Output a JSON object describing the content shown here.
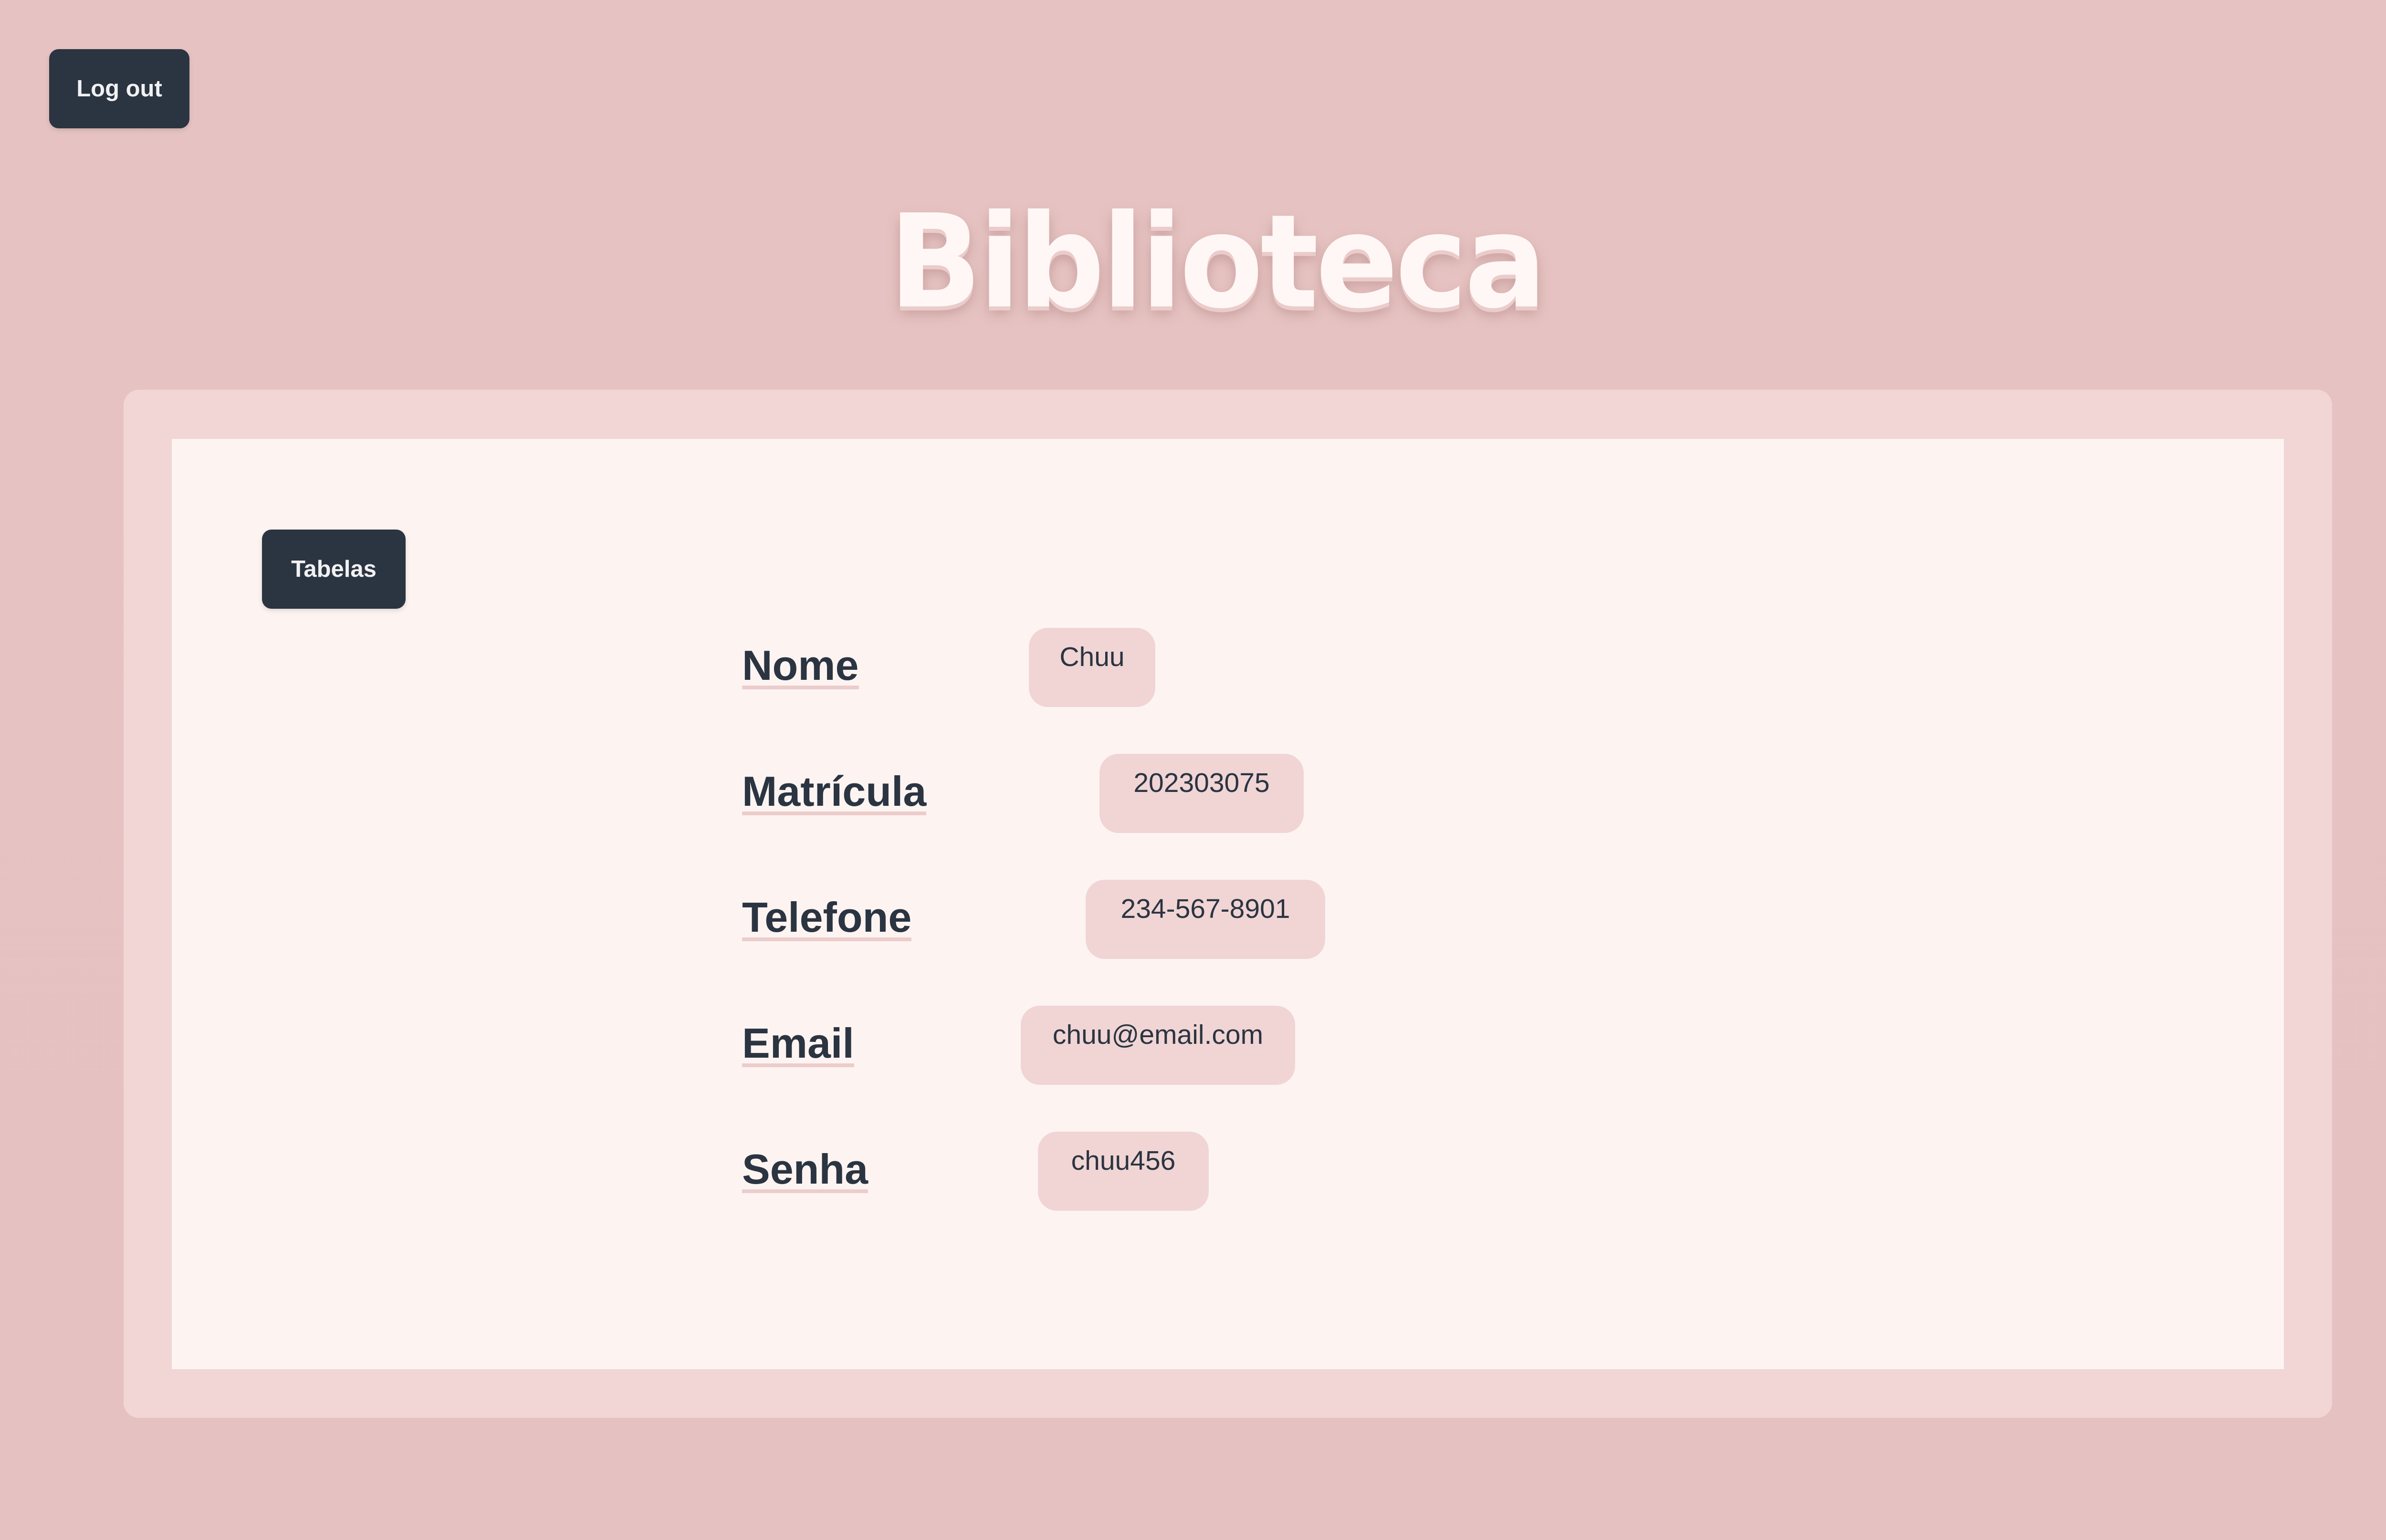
{
  "header": {
    "logout_label": "Log out",
    "title": "Biblioteca"
  },
  "panel": {
    "tabelas_label": "Tabelas",
    "fields": [
      {
        "label": "Nome",
        "value": "Chuu"
      },
      {
        "label": "Matrícula",
        "value": "202303075"
      },
      {
        "label": "Telefone",
        "value": "234-567-8901"
      },
      {
        "label": "Email",
        "value": "chuu@email.com"
      },
      {
        "label": "Senha",
        "value": "chuu456"
      }
    ]
  },
  "colors": {
    "background": "#e6c3c2",
    "card": "#f1d6d5",
    "panel": "#fdf4f2",
    "button": "#2b3441",
    "value_pill": "#f0d5d4",
    "title": "#fff7f5"
  }
}
